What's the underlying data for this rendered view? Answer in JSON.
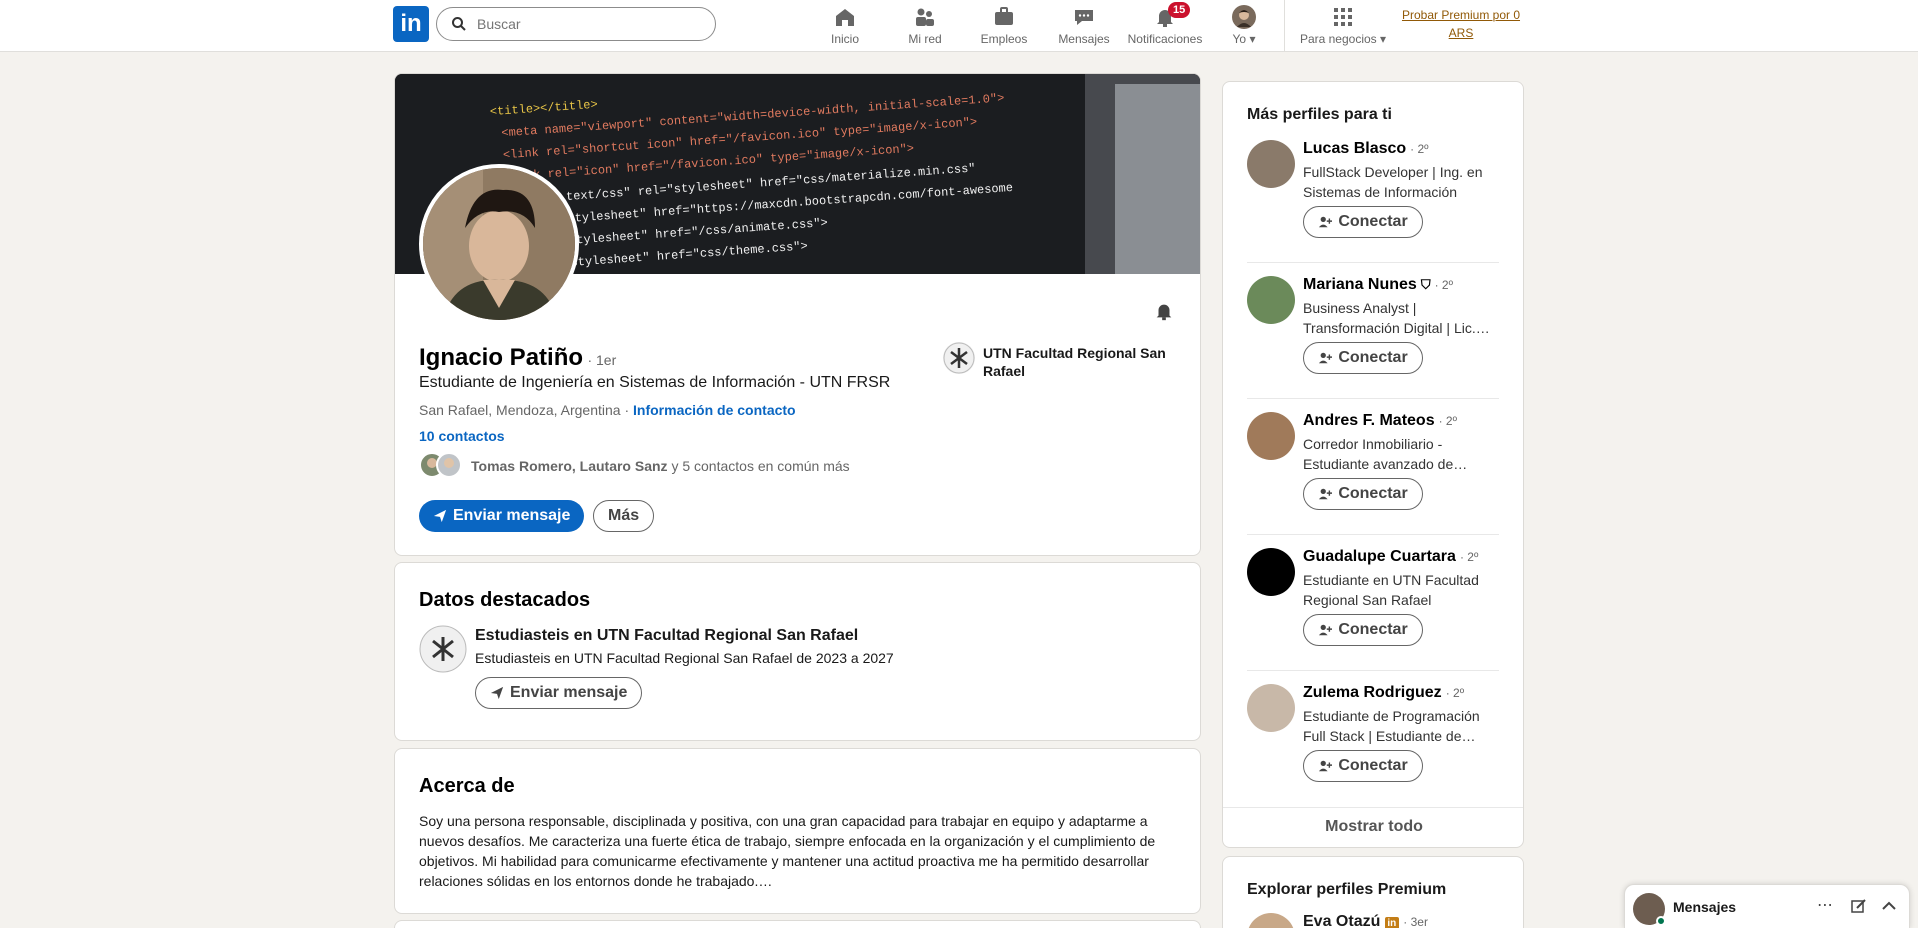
{
  "nav": {
    "logo": "in",
    "search_placeholder": "Buscar",
    "items": [
      {
        "label": "Inicio"
      },
      {
        "label": "Mi red"
      },
      {
        "label": "Empleos"
      },
      {
        "label": "Mensajes"
      },
      {
        "label": "Notificaciones",
        "badge": "15"
      },
      {
        "label": "Yo"
      },
      {
        "label": "Para negocios"
      }
    ],
    "premium": "Probar Premium por 0 ARS"
  },
  "profile": {
    "name": "Ignacio Patiño",
    "degree": "· 1er",
    "headline": "Estudiante de Ingeniería en Sistemas de Información - UTN FRSR",
    "location": "San Rafael, Mendoza, Argentina ·",
    "contact_info": "Información de contacto",
    "connections": "10 contactos",
    "mutual_names": "Tomas Romero, Lautaro Sanz",
    "mutual_more": "y 5 contactos en común más",
    "school": "UTN Facultad Regional San Rafael",
    "send_message": "Enviar mensaje",
    "more": "Más"
  },
  "highlights": {
    "title": "Datos destacados",
    "item_title": "Estudiasteis en UTN Facultad Regional San Rafael",
    "item_sub": "Estudiasteis en UTN Facultad Regional San Rafael de 2023 a 2027",
    "button": "Enviar mensaje"
  },
  "about": {
    "title": "Acerca de",
    "text": "Soy una persona responsable, disciplinada y positiva, con una gran capacidad para trabajar en equipo y adaptarme a nuevos desafíos. Me caracteriza una fuerte ética de trabajo, siempre enfocada en la organización y el cumplimiento de objetivos. Mi habilidad para comunicarme efectivamente y mantener una actitud proactiva me ha permitido desarrollar relaciones sólidas en los entornos donde he trabajado.…"
  },
  "sidebar": {
    "title": "Más perfiles para ti",
    "people": [
      {
        "name": "Lucas Blasco",
        "degree": "· 2º",
        "headline": "FullStack Developer | Ing. en Sistemas de Información",
        "color": "#8a7a6a"
      },
      {
        "name": "Mariana Nunes",
        "degree": "· 2º",
        "headline": "Business Analyst | Transformación Digital | Lic.…",
        "color": "#6b8a5a"
      },
      {
        "name": "Andres F. Mateos",
        "degree": "· 2º",
        "headline": "Corredor Inmobiliario - Estudiante avanzado de…",
        "color": "#a07a5a"
      },
      {
        "name": "Guadalupe Cuartara",
        "degree": "· 2º",
        "headline": "Estudiante en UTN Facultad Regional San Rafael",
        "color": "#000000"
      },
      {
        "name": "Zulema Rodriguez",
        "degree": "· 2º",
        "headline": "Estudiante de Programación Full Stack | Estudiante de…",
        "color": "#c8b8a8"
      }
    ],
    "connect": "Conectar",
    "show_all": "Mostrar todo",
    "premium_title": "Explorar perfiles Premium",
    "premium_person": "Eva Otazú",
    "premium_degree": "· 3er"
  },
  "messaging": {
    "label": "Mensajes"
  },
  "colors": {
    "brand": "#0a66c2",
    "background": "#f4f2ee",
    "badge": "#cb112d"
  }
}
